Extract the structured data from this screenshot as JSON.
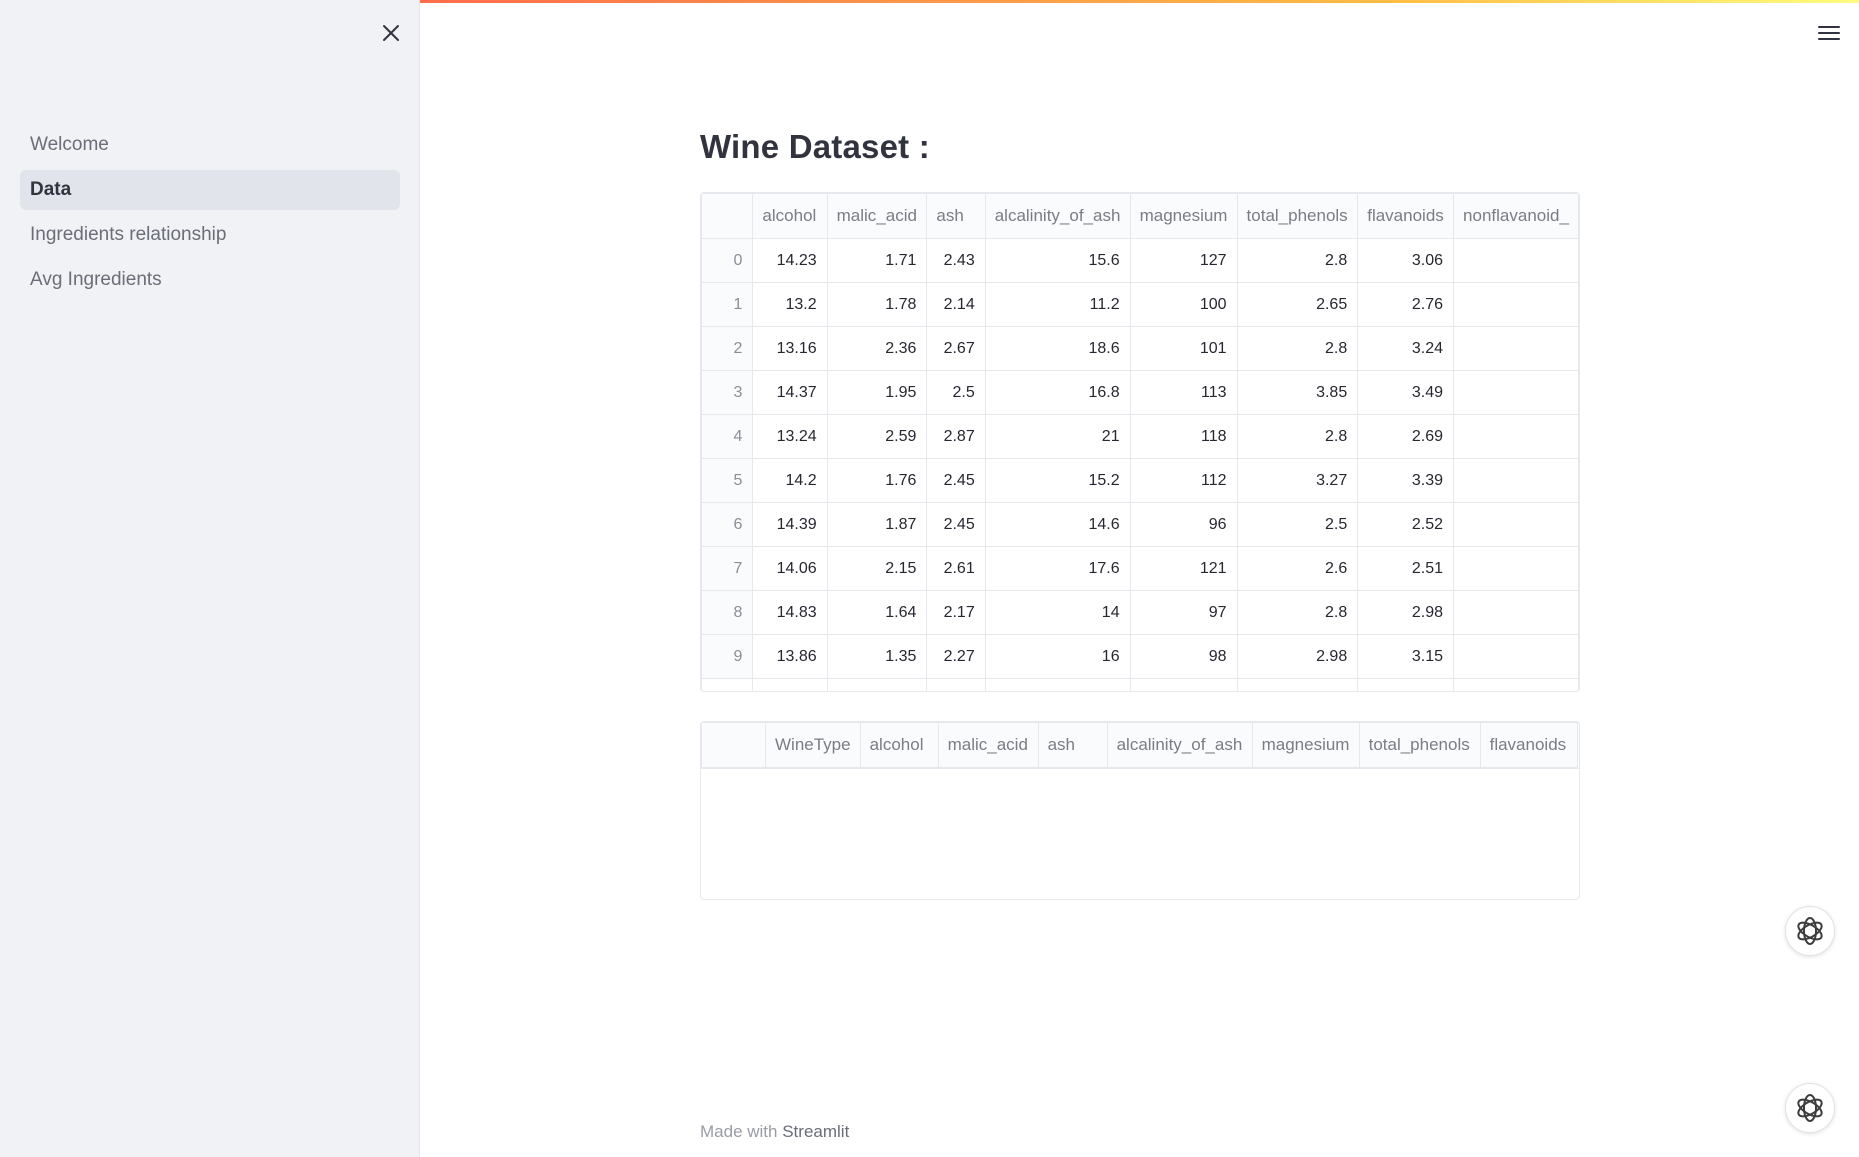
{
  "sidebar": {
    "items": [
      {
        "label": "Welcome",
        "active": false
      },
      {
        "label": "Data",
        "active": true
      },
      {
        "label": "Ingredients relationship",
        "active": false
      },
      {
        "label": "Avg Ingredients",
        "active": false
      }
    ]
  },
  "main": {
    "title": "Wine Dataset :",
    "table1": {
      "columns": [
        "alcohol",
        "malic_acid",
        "ash",
        "alcalinity_of_ash",
        "magnesium",
        "total_phenols",
        "flavanoids",
        "nonflavanoid_"
      ],
      "rows": [
        {
          "index": "0",
          "cells": [
            "14.23",
            "1.71",
            "2.43",
            "15.6",
            "127",
            "2.8",
            "3.06",
            ""
          ]
        },
        {
          "index": "1",
          "cells": [
            "13.2",
            "1.78",
            "2.14",
            "11.2",
            "100",
            "2.65",
            "2.76",
            ""
          ]
        },
        {
          "index": "2",
          "cells": [
            "13.16",
            "2.36",
            "2.67",
            "18.6",
            "101",
            "2.8",
            "3.24",
            ""
          ]
        },
        {
          "index": "3",
          "cells": [
            "14.37",
            "1.95",
            "2.5",
            "16.8",
            "113",
            "3.85",
            "3.49",
            ""
          ]
        },
        {
          "index": "4",
          "cells": [
            "13.24",
            "2.59",
            "2.87",
            "21",
            "118",
            "2.8",
            "2.69",
            ""
          ]
        },
        {
          "index": "5",
          "cells": [
            "14.2",
            "1.76",
            "2.45",
            "15.2",
            "112",
            "3.27",
            "3.39",
            ""
          ]
        },
        {
          "index": "6",
          "cells": [
            "14.39",
            "1.87",
            "2.45",
            "14.6",
            "96",
            "2.5",
            "2.52",
            ""
          ]
        },
        {
          "index": "7",
          "cells": [
            "14.06",
            "2.15",
            "2.61",
            "17.6",
            "121",
            "2.6",
            "2.51",
            ""
          ]
        },
        {
          "index": "8",
          "cells": [
            "14.83",
            "1.64",
            "2.17",
            "14",
            "97",
            "2.8",
            "2.98",
            ""
          ]
        },
        {
          "index": "9",
          "cells": [
            "13.86",
            "1.35",
            "2.27",
            "16",
            "98",
            "2.98",
            "3.15",
            ""
          ]
        }
      ]
    },
    "table2": {
      "columns": [
        "WineType",
        "alcohol",
        "malic_acid",
        "ash",
        "alcalinity_of_ash",
        "magnesium",
        "total_phenols",
        "flavanoids"
      ]
    }
  },
  "footer": {
    "prefix": "Made with",
    "brand": "Streamlit"
  },
  "icons": {
    "close": "close-icon",
    "menu": "hamburger-menu-icon",
    "assistant": "openai-logo-icon"
  }
}
